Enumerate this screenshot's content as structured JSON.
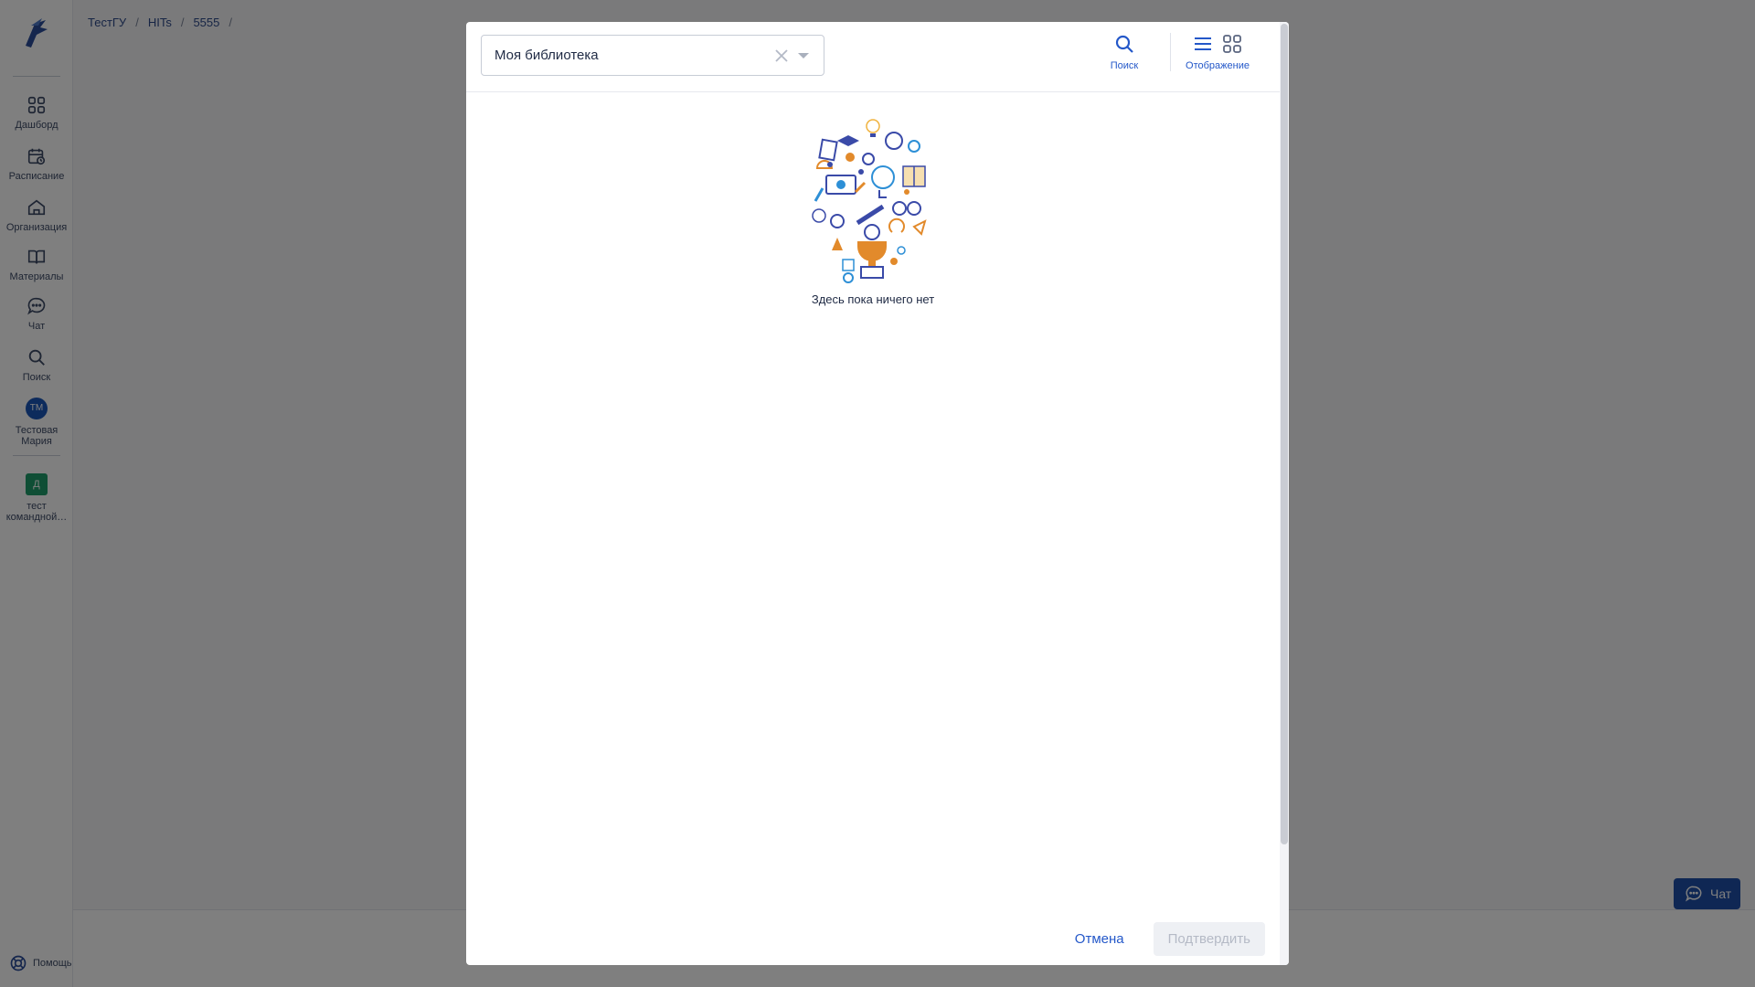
{
  "sidebar": {
    "items": [
      {
        "label": "Дашборд",
        "icon": "dashboard-icon"
      },
      {
        "label": "Расписание",
        "icon": "calendar-icon"
      },
      {
        "label": "Организация",
        "icon": "home-icon"
      },
      {
        "label": "Материалы",
        "icon": "book-icon"
      },
      {
        "label": "Чат",
        "icon": "chat-icon"
      },
      {
        "label": "Поиск",
        "icon": "search-icon"
      }
    ],
    "user": {
      "initials": "ТМ",
      "name": "Тестовая Мария"
    },
    "team": {
      "initial": "Д",
      "name": "тест командной…"
    },
    "help_label": "Помощь"
  },
  "breadcrumb": [
    "ТестГУ",
    "HITs",
    "5555"
  ],
  "chat_button": {
    "label": "Чат"
  },
  "modal": {
    "library_select": {
      "value": "Моя библиотека"
    },
    "tools": {
      "search_label": "Поиск",
      "view_label": "Отображение"
    },
    "empty_state": {
      "text": "Здесь пока ничего нет"
    },
    "footer": {
      "cancel_label": "Отмена",
      "confirm_label": "Подтвердить"
    }
  },
  "colors": {
    "accent": "#2458c9",
    "overlay": "rgba(0,0,0,0.5)",
    "avatar": "#1a56b8",
    "team_badge": "#1f9d6b"
  }
}
